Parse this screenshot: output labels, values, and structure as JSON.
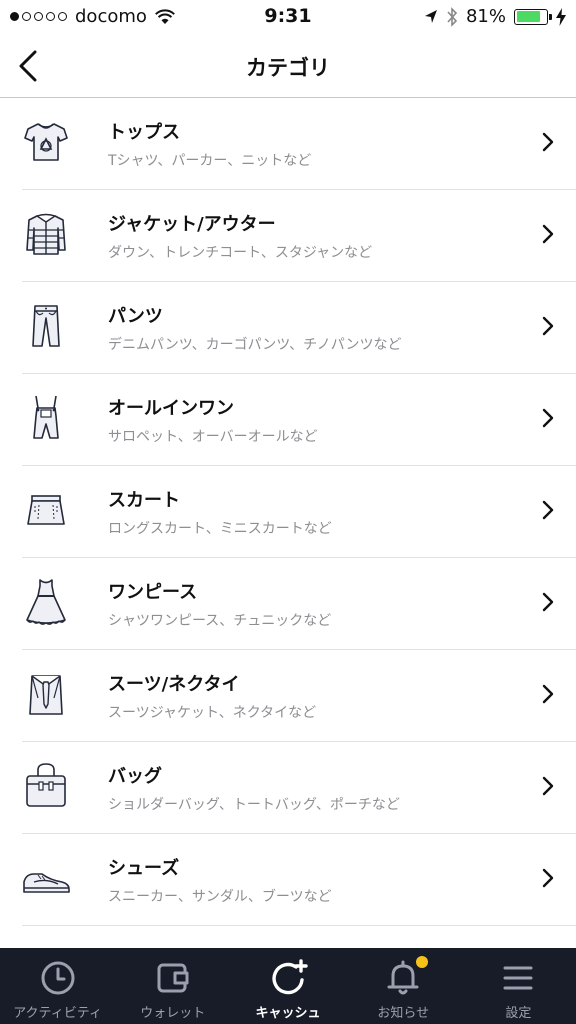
{
  "status_bar": {
    "carrier": "docomo",
    "time": "9:31",
    "battery_percent": "81%",
    "battery_level": 0.81,
    "signal_bars_filled": 1,
    "signal_bars_total": 5
  },
  "nav": {
    "title": "カテゴリ",
    "back_icon": "chevron-left-icon"
  },
  "categories": [
    {
      "name": "トップス",
      "description": "Tシャツ、パーカー、ニットなど",
      "icon": "tshirt-icon"
    },
    {
      "name": "ジャケット/アウター",
      "description": "ダウン、トレンチコート、スタジャンなど",
      "icon": "jacket-icon"
    },
    {
      "name": "パンツ",
      "description": "デニムパンツ、カーゴパンツ、チノパンツなど",
      "icon": "pants-icon"
    },
    {
      "name": "オールインワン",
      "description": "サロペット、オーバーオールなど",
      "icon": "overalls-icon"
    },
    {
      "name": "スカート",
      "description": "ロングスカート、ミニスカートなど",
      "icon": "skirt-icon"
    },
    {
      "name": "ワンピース",
      "description": "シャツワンピース、チュニックなど",
      "icon": "dress-icon"
    },
    {
      "name": "スーツ/ネクタイ",
      "description": "スーツジャケット、ネクタイなど",
      "icon": "suit-tie-icon"
    },
    {
      "name": "バッグ",
      "description": "ショルダーバッグ、トートバッグ、ポーチなど",
      "icon": "bag-icon"
    },
    {
      "name": "シューズ",
      "description": "スニーカー、サンダル、ブーツなど",
      "icon": "sneaker-icon"
    }
  ],
  "tab_bar": {
    "items": [
      {
        "label": "アクティビティ",
        "icon": "clock-icon",
        "active": false
      },
      {
        "label": "ウォレット",
        "icon": "wallet-icon",
        "active": false
      },
      {
        "label": "キャッシュ",
        "icon": "cash-refresh-plus-icon",
        "active": true
      },
      {
        "label": "お知らせ",
        "icon": "bell-icon",
        "active": false,
        "badge": true
      },
      {
        "label": "設定",
        "icon": "menu-icon",
        "active": false
      }
    ]
  },
  "colors": {
    "tab_bar_bg": "#181c28",
    "badge": "#f7c31b",
    "battery": "#4cd964",
    "subtext": "#8e8e93"
  }
}
